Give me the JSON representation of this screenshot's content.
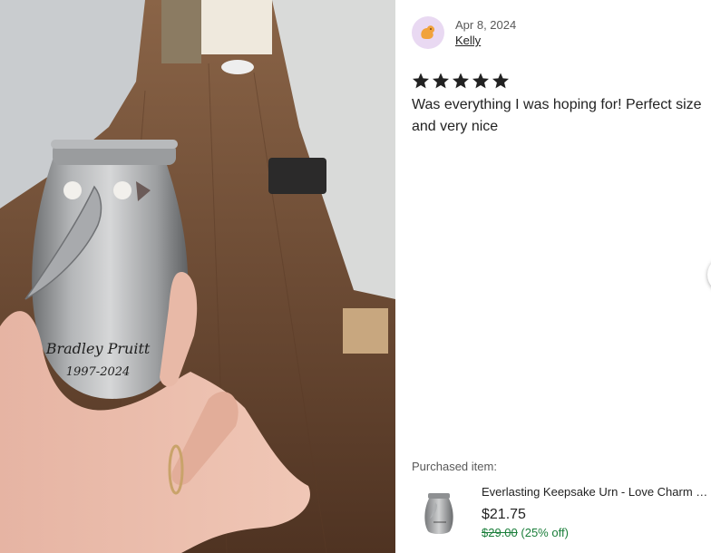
{
  "photo": {
    "engraving_name": "Bradley Pruitt",
    "engraving_years": "1997-2024"
  },
  "review": {
    "date": "Apr 8, 2024",
    "reviewer_name": "Kelly",
    "rating": 5,
    "text": "Was everything I was hoping for! Perfect size and very nice"
  },
  "purchased": {
    "label": "Purchased item:",
    "title": "Everlasting Keepsake Urn - Love Charm Pet Memorial Urn",
    "price": "$21.75",
    "original_price": "$29.00",
    "discount": "(25% off)"
  },
  "icons": {
    "avatar": "bird-avatar-icon",
    "star": "star-icon",
    "next": "next-arrow-icon"
  },
  "colors": {
    "star": "#222222",
    "sale": "#1a7e3a",
    "avatar_bg": "#e9d9f2",
    "avatar_fg": "#f1a33c"
  }
}
